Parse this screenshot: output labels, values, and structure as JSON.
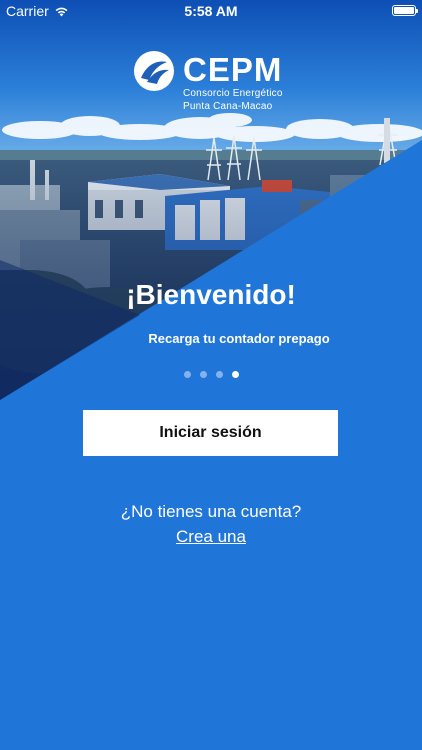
{
  "status_bar": {
    "carrier": "Carrier",
    "time": "5:58 AM",
    "icons": [
      "wifi-icon",
      "battery-icon"
    ]
  },
  "logo": {
    "name": "CEPM",
    "subtitle_line1": "Consorcio Energético",
    "subtitle_line2": "Punta Cana-Macao"
  },
  "welcome": {
    "title": "¡Bienvenido!",
    "subtitle": "Recarga tu contador prepago"
  },
  "pager": {
    "count": 4,
    "active_index": 3
  },
  "actions": {
    "login_label": "Iniciar sesión",
    "signup_question": "¿No tienes una cuenta?",
    "signup_link": "Crea una"
  },
  "colors": {
    "brand_blue": "#1f76d8",
    "dark_overlay": "#0f2a66",
    "button_bg": "#ffffff"
  }
}
